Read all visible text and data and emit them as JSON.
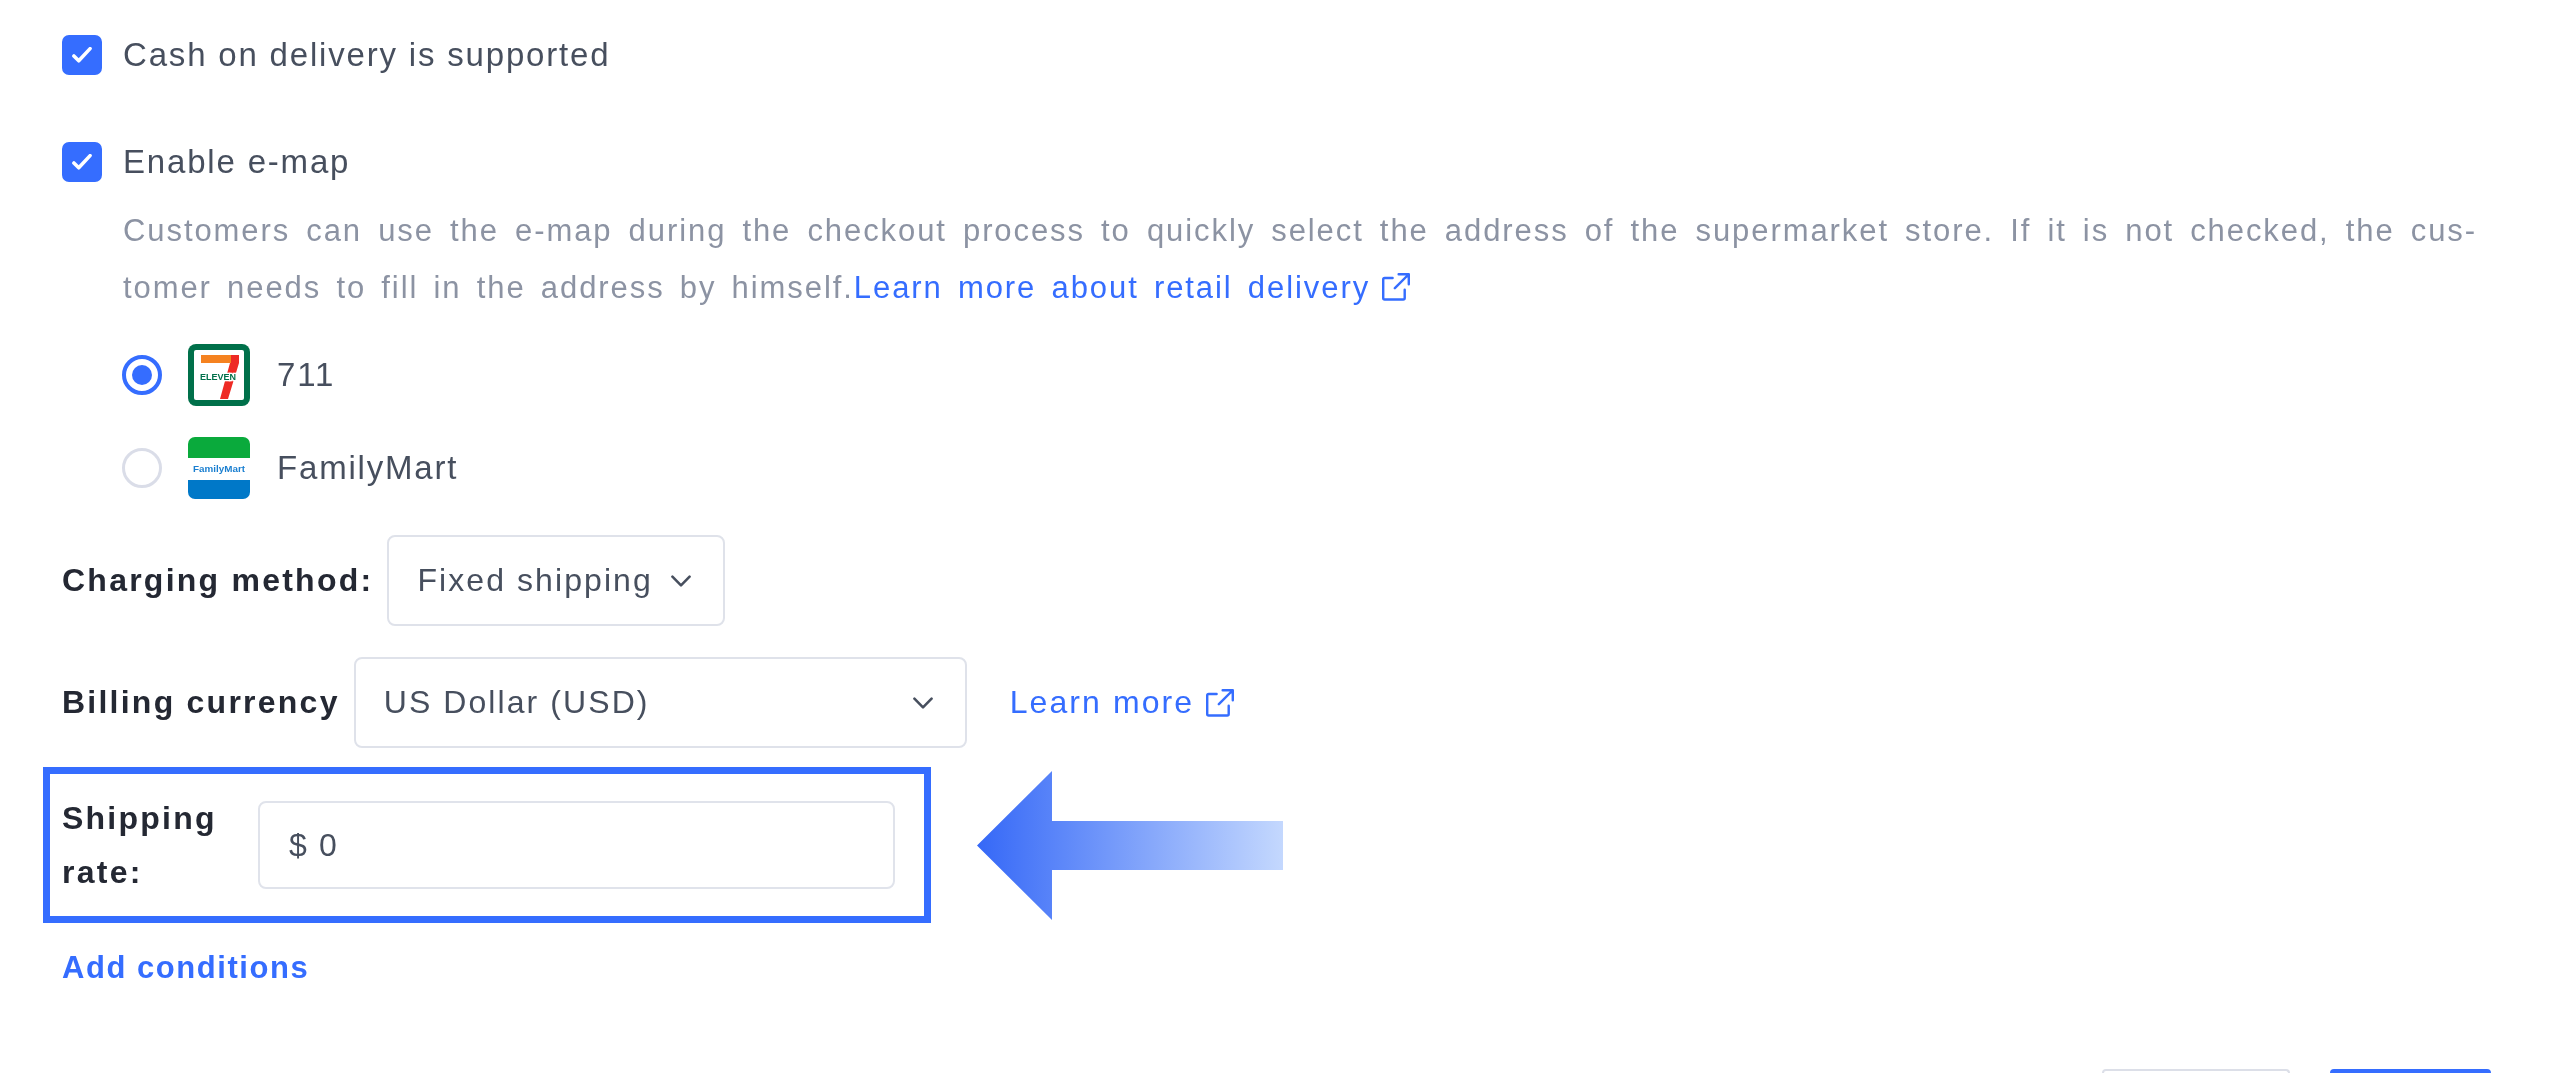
{
  "cash_on_delivery": {
    "label": "Cash on delivery is supported",
    "checked": true
  },
  "e_map": {
    "label": "Enable e-map",
    "checked": true,
    "description": "Customers can use the e-map during the checkout process to quickly select the address of the supermarket store. If it is not checked, the cus- tomer needs to fill in the address by himself.",
    "link": "Learn more about retail delivery",
    "stores": [
      {
        "name": "711",
        "selected": true,
        "logo": {
          "kind": "eleven",
          "text": "ELEVEN"
        }
      },
      {
        "name": "FamilyMart",
        "selected": false,
        "logo": {
          "kind": "familymart",
          "text": "FamilyMart"
        }
      }
    ]
  },
  "charging_method": {
    "label": "Charging method:",
    "value": "Fixed shipping"
  },
  "billing_currency": {
    "label": "Billing currency",
    "value": "US Dollar (USD)",
    "link": "Learn more"
  },
  "shipping_rate": {
    "label": "Shipping rate:",
    "prefix": "$",
    "value": "0"
  },
  "add_conditions": "Add conditions"
}
